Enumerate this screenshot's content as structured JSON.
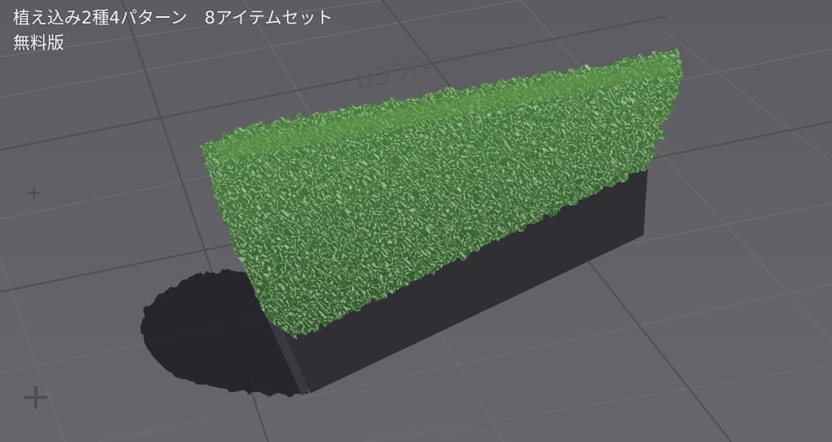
{
  "overlay": {
    "title_line1": "植え込み2種4パターン　8アイテムセット",
    "title_line2": "無料版"
  },
  "colors": {
    "floor": "#616166",
    "grid": "#6f6f75",
    "hedge_dark": "#2f5a28",
    "hedge_light": "#6fa25a",
    "planter": "#2e2e33"
  }
}
